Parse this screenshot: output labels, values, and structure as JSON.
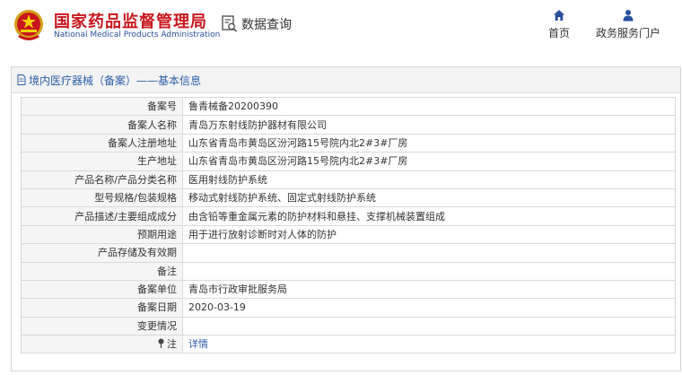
{
  "header": {
    "brand_cn": "国家药品监督管理局",
    "brand_en": "National Medical Products Administration",
    "query_label": "数据查询",
    "nav": [
      {
        "label": "首页",
        "icon": "home-icon"
      },
      {
        "label": "政务服务门户",
        "icon": "user-icon"
      }
    ]
  },
  "panel": {
    "title": "境内医疗器械（备案）——基本信息",
    "rows": [
      {
        "label": "备案号",
        "value": "鲁青械备20200390"
      },
      {
        "label": "备案人名称",
        "value": "青岛万东射线防护器材有限公司"
      },
      {
        "label": "备案人注册地址",
        "value": "山东省青岛市黄岛区汾河路15号院内北2#3#厂房"
      },
      {
        "label": "生产地址",
        "value": "山东省青岛市黄岛区汾河路15号院内北2#3#厂房"
      },
      {
        "label": "产品名称/产品分类名称",
        "value": "医用射线防护系统"
      },
      {
        "label": "型号规格/包装规格",
        "value": "移动式射线防护系统、固定式射线防护系统"
      },
      {
        "label": "产品描述/主要组成成分",
        "value": "由含铅等重金属元素的防护材料和悬挂、支撑机械装置组成"
      },
      {
        "label": "预期用途",
        "value": "用于进行放射诊断时对人体的防护"
      },
      {
        "label": "产品存储及有效期",
        "value": ""
      },
      {
        "label": "备注",
        "value": ""
      },
      {
        "label": "备案单位",
        "value": "青岛市行政审批服务局"
      },
      {
        "label": "备案日期",
        "value": "2020-03-19"
      },
      {
        "label": "变更情况",
        "value": ""
      }
    ],
    "note_row": {
      "label": "注",
      "link": "详情"
    }
  },
  "colors": {
    "brand_red": "#c8161e",
    "link_blue": "#2a5fa8",
    "nav_blue": "#2a4f9e"
  }
}
